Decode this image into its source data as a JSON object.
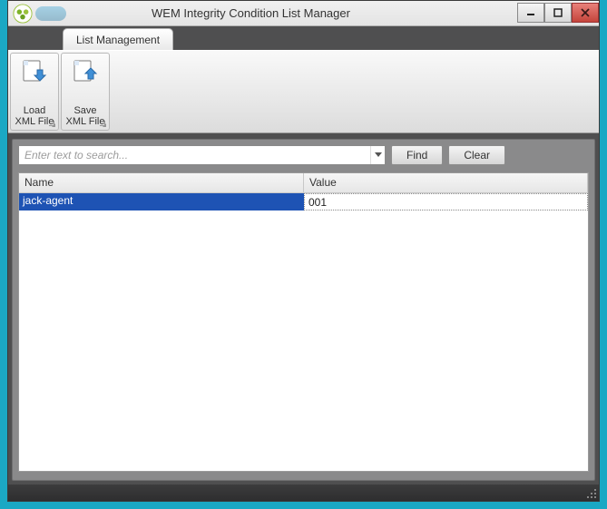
{
  "window": {
    "title": "WEM Integrity Condition List Manager"
  },
  "tabs": {
    "active": "List Management"
  },
  "ribbon": {
    "load_label": "Load XML File",
    "save_label": "Save XML File"
  },
  "search": {
    "placeholder": "Enter text to search...",
    "value": "",
    "find_label": "Find",
    "clear_label": "Clear"
  },
  "grid": {
    "columns": {
      "name": "Name",
      "value": "Value"
    },
    "rows": [
      {
        "name": "jack-agent",
        "value": "001"
      }
    ]
  }
}
